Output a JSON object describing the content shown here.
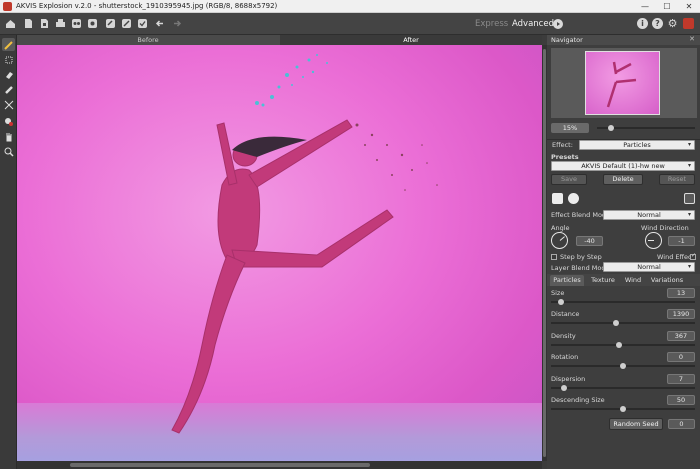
{
  "window": {
    "title": "AKVIS Explosion v.2.0 - shutterstock_1910395945.jpg (RGB/8, 8688x5792)",
    "minimize": "—",
    "maximize": "☐",
    "close": "✕"
  },
  "toolbar": {
    "mode_express": "Express",
    "mode_advanced": "Advanced",
    "info": "i",
    "help": "?",
    "settings": "⚙"
  },
  "canvas_tabs": {
    "before": "Before",
    "after": "After"
  },
  "navigator": {
    "title": "Navigator",
    "close": "✕",
    "zoom": "15%",
    "zoom_level": 0.12
  },
  "effect": {
    "label": "Effect:",
    "value": "Particles"
  },
  "presets": {
    "label": "Presets",
    "value": "AKVIS Default (1)-hw new",
    "save": "Save",
    "delete": "Delete",
    "reset": "Reset"
  },
  "blend": {
    "effect_label": "Effect Blend Mode",
    "effect_value": "Normal",
    "layer_label": "Layer Blend Mode",
    "layer_value": "Normal"
  },
  "angle": {
    "label": "Angle",
    "value": "-40"
  },
  "wind_direction": {
    "label": "Wind Direction",
    "value": "-1"
  },
  "step_by_step": {
    "label": "Step by Step",
    "checked": false
  },
  "wind_effect": {
    "label": "Wind Effect",
    "checked": true
  },
  "subtabs": [
    "Particles",
    "Texture",
    "Wind",
    "Variations"
  ],
  "params": [
    {
      "label": "Size",
      "value": "13",
      "pos": 0.05
    },
    {
      "label": "Distance",
      "value": "1390",
      "pos": 0.45
    },
    {
      "label": "Density",
      "value": "367",
      "pos": 0.47
    },
    {
      "label": "Rotation",
      "value": "0",
      "pos": 0.5
    },
    {
      "label": "Dispersion",
      "value": "7",
      "pos": 0.07
    },
    {
      "label": "Descending Size",
      "value": "50",
      "pos": 0.5
    }
  ],
  "random_seed": {
    "label": "Random Seed",
    "value": "0"
  },
  "colors": {
    "accent_red": "#c0392b",
    "panel": "#3e3e3e",
    "canvas_pink": "#eb6ed6"
  }
}
